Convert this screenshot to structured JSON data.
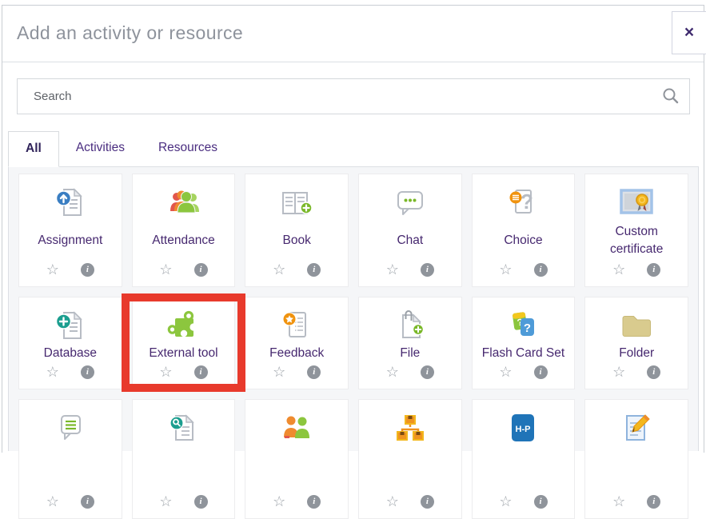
{
  "dialog": {
    "title": "Add an activity or resource",
    "close_glyph": "×"
  },
  "search": {
    "placeholder": "Search"
  },
  "tabs": [
    {
      "label": "All",
      "active": true
    },
    {
      "label": "Activities",
      "active": false
    },
    {
      "label": "Resources",
      "active": false
    }
  ],
  "icons": {
    "star": "☆",
    "info": "i",
    "h5p_logo_text": "H-P"
  },
  "colors": {
    "accent_purple": "#46286f",
    "tab_link_purple": "#4a2d80",
    "highlight_red": "#e83a2c",
    "panel_bg": "#f5f6f8",
    "green": "#8cc63e",
    "orange": "#f0930f",
    "teal": "#1b9e8f",
    "blue": "#3a7ec2"
  },
  "grid": {
    "items": [
      {
        "label": "Assignment",
        "icon": "assignment-icon"
      },
      {
        "label": "Attendance",
        "icon": "attendance-icon"
      },
      {
        "label": "Book",
        "icon": "book-icon"
      },
      {
        "label": "Chat",
        "icon": "chat-icon"
      },
      {
        "label": "Choice",
        "icon": "choice-icon"
      },
      {
        "label": "Custom certificate",
        "icon": "custom-certificate-icon"
      },
      {
        "label": "Database",
        "icon": "database-icon"
      },
      {
        "label": "External tool",
        "icon": "external-tool-icon",
        "highlighted": true
      },
      {
        "label": "Feedback",
        "icon": "feedback-icon"
      },
      {
        "label": "File",
        "icon": "file-icon"
      },
      {
        "label": "Flash Card Set",
        "icon": "flash-card-set-icon"
      },
      {
        "label": "Folder",
        "icon": "folder-icon"
      },
      {
        "label": "",
        "icon": "forum-icon"
      },
      {
        "label": "",
        "icon": "glossary-icon"
      },
      {
        "label": "",
        "icon": "group-choice-icon"
      },
      {
        "label": "",
        "icon": "lesson-icon"
      },
      {
        "label": "",
        "icon": "h5p-icon"
      },
      {
        "label": "",
        "icon": "journal-icon"
      }
    ]
  }
}
